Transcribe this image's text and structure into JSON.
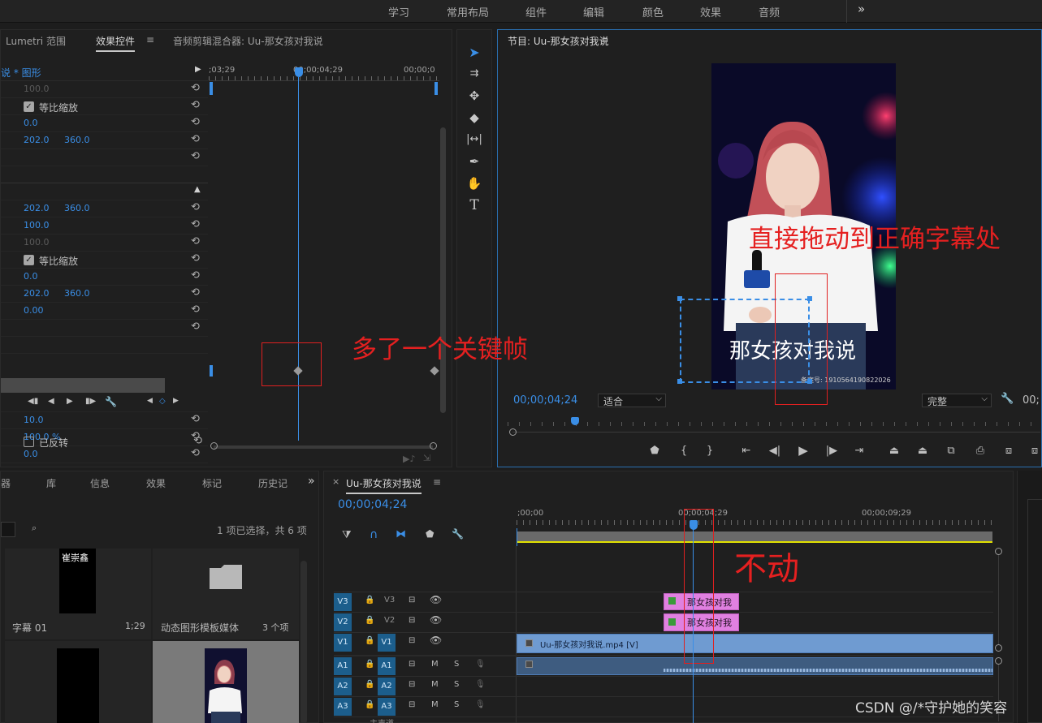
{
  "workspaces": [
    "学习",
    "常用布局",
    "组件",
    "编辑",
    "颜色",
    "效果",
    "音频"
  ],
  "workspace_more": "»",
  "effect_panel": {
    "tabs": [
      "Lumetri 范围",
      "效果控件",
      "音频剪辑混合器: Uu-那女孩对我说"
    ],
    "menu": "≡",
    "clip_label": "说 * 图形",
    "ruler": {
      "left": ";03;29",
      "mid": "00;00;04;29",
      "right": "00;00;0"
    },
    "rows": [
      {
        "a": "100.0",
        "dim": true
      },
      {
        "check": true,
        "label": "等比缩放"
      },
      {
        "a": "0.0"
      },
      {
        "a": "202.0",
        "b": "360.0"
      },
      {},
      {
        "collapse": true
      },
      {},
      {
        "a": "202.0",
        "b": "360.0"
      },
      {
        "a": "100.0"
      },
      {
        "a": "100.0",
        "dim": true
      },
      {
        "check": true,
        "label": "等比缩放"
      },
      {
        "a": "0.0"
      },
      {
        "a": "202.0",
        "b": "360.0"
      },
      {
        "a": "0.00"
      },
      {},
      {},
      {
        "transport": true
      },
      {
        "a": "10.0"
      },
      {
        "a": "100.0 %"
      },
      {
        "a": "0.0"
      },
      {
        "check": false,
        "label": "已反转"
      }
    ]
  },
  "program": {
    "title": "节目: Uu-那女孩对我说",
    "menu": "≡",
    "timecode": "00;00;04;24",
    "fit": "适合",
    "quality": "完整",
    "timecode_right": "00;",
    "subtitle": "那女孩对我说",
    "watermark": "备案号: 1910564190822026"
  },
  "annotations": {
    "drag": "直接拖动到正确字幕处",
    "extra_keyframe": "多了一个关键帧",
    "no_move": "不动"
  },
  "project_panel": {
    "tabs": [
      "器",
      "库",
      "信息",
      "效果",
      "标记",
      "历史记"
    ],
    "more": "»",
    "selection": "1 项已选择，共 6 项",
    "items": [
      {
        "name": "字幕 01",
        "meta": "1;29",
        "thumb_text": "崔崇鑫"
      },
      {
        "name": "动态图形模板媒体",
        "meta": "3 个项"
      }
    ]
  },
  "timeline": {
    "close": "×",
    "title": "Uu-那女孩对我说",
    "menu": "≡",
    "timecode": "00;00;04;24",
    "ruler": [
      ";00;00",
      "00;00;04;29",
      "00;00;09;29"
    ],
    "tracks": [
      {
        "id": "V3",
        "src": "",
        "type": "video"
      },
      {
        "id": "V2",
        "src": "",
        "type": "video"
      },
      {
        "id": "V1",
        "src": "V1",
        "type": "video"
      },
      {
        "id": "A1",
        "src": "A1",
        "type": "audio"
      },
      {
        "id": "A2",
        "src": "A2",
        "type": "audio"
      },
      {
        "id": "A3",
        "src": "A3",
        "type": "audio"
      }
    ],
    "track_labels": [
      "V3",
      "V2",
      "V1",
      "A1",
      "A2",
      "A3"
    ],
    "clip_v3": "那女孩对我",
    "clip_v2": "那女孩对我",
    "clip_v1": "Uu-那女孩对我说.mp4 [V]",
    "footer": "主声道"
  },
  "csdn_watermark": "CSDN @/*守护她的笑容"
}
